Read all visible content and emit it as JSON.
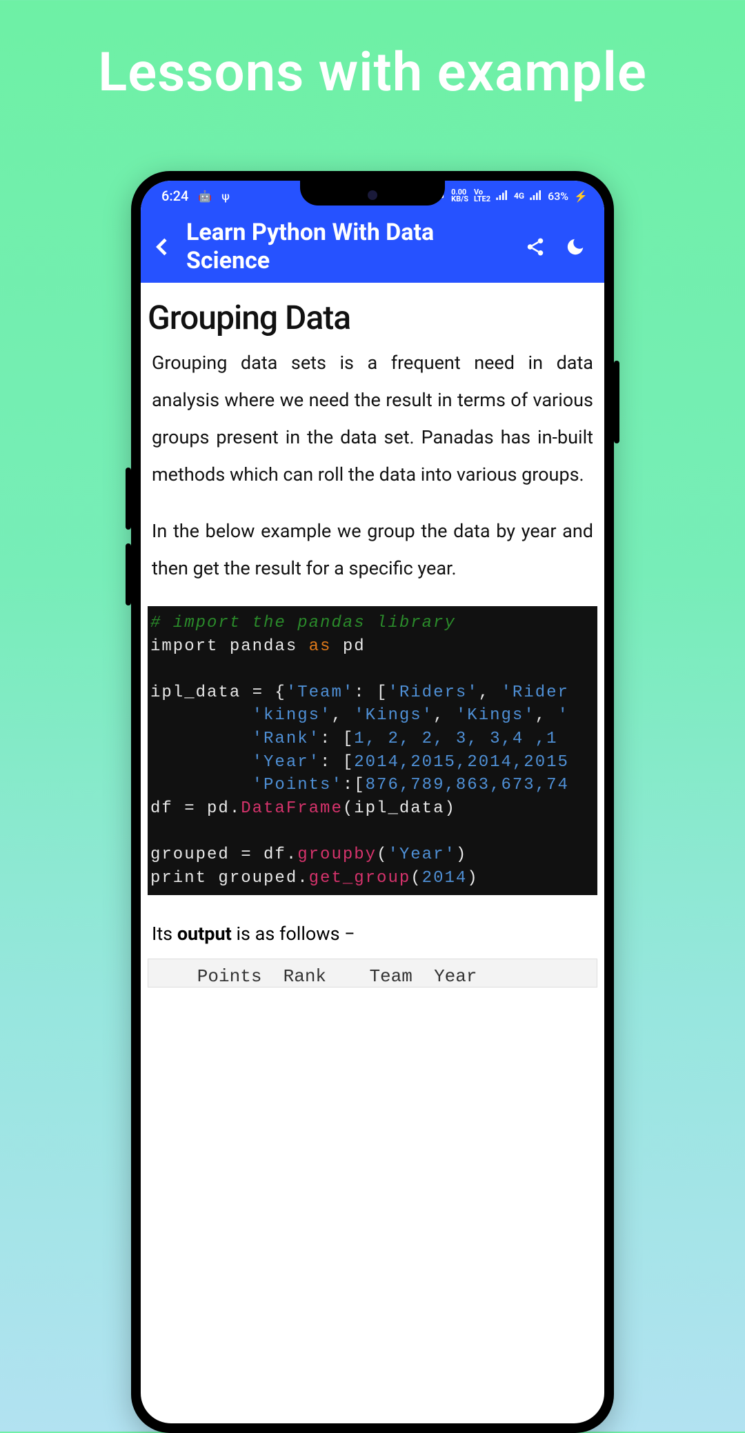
{
  "hero": {
    "title": "Lessons with example"
  },
  "status_bar": {
    "time": "6:24",
    "speed_top": "0.00",
    "speed_bottom": "KB/S",
    "net_top": "Vo",
    "net_bottom": "LTE2",
    "signal_label": "4G",
    "battery": "63%",
    "charging": "⚡"
  },
  "app_bar": {
    "title": "Learn Python With Data Science"
  },
  "lesson": {
    "title": "Grouping Data",
    "para1": "Grouping data sets is a frequent need in data analysis where we need the result in terms of various groups present in the data set. Panadas has in-built methods which can roll the data into various groups.",
    "para2": "In the below example we group the data by year and then get the result for a specific year.",
    "code": {
      "line1_comment": "# import the pandas library",
      "line2_a": "import pandas ",
      "line2_kw": "as",
      "line2_b": " pd",
      "line4_a": "ipl_data = {",
      "line4_key": "'Team'",
      "line4_b": ": [",
      "line4_v1": "'Riders'",
      "line4_v2": "'Rider",
      "line5_v1": "'kings'",
      "line5_v2": "'Kings'",
      "line5_v3": "'Kings'",
      "line6_key": "'Rank'",
      "line6_vals": "1, 2, 2, 3, 3,4 ,1",
      "line7_key": "'Year'",
      "line7_vals": "2014,2015,2014,2015",
      "line8_key": "'Points'",
      "line8_vals": "876,789,863,673,74",
      "line9_a": "df = pd.",
      "line9_fn": "DataFrame",
      "line9_b": "(ipl_data)",
      "line11_a": "grouped = df.",
      "line11_fn": "groupby",
      "line11_b": "(",
      "line11_arg": "'Year'",
      "line11_c": ")",
      "line12_a": "print grouped.",
      "line12_fn": "get_group",
      "line12_b": "(",
      "line12_arg": "2014",
      "line12_c": ")"
    },
    "output_intro_a": "Its ",
    "output_intro_b": "output",
    "output_intro_c": " is as follows −",
    "output_header": "   Points  Rank    Team  Year"
  },
  "chart_data": {
    "type": "table",
    "title": "Grouped output for Year 2014",
    "columns": [
      "Points",
      "Rank",
      "Team",
      "Year"
    ]
  }
}
